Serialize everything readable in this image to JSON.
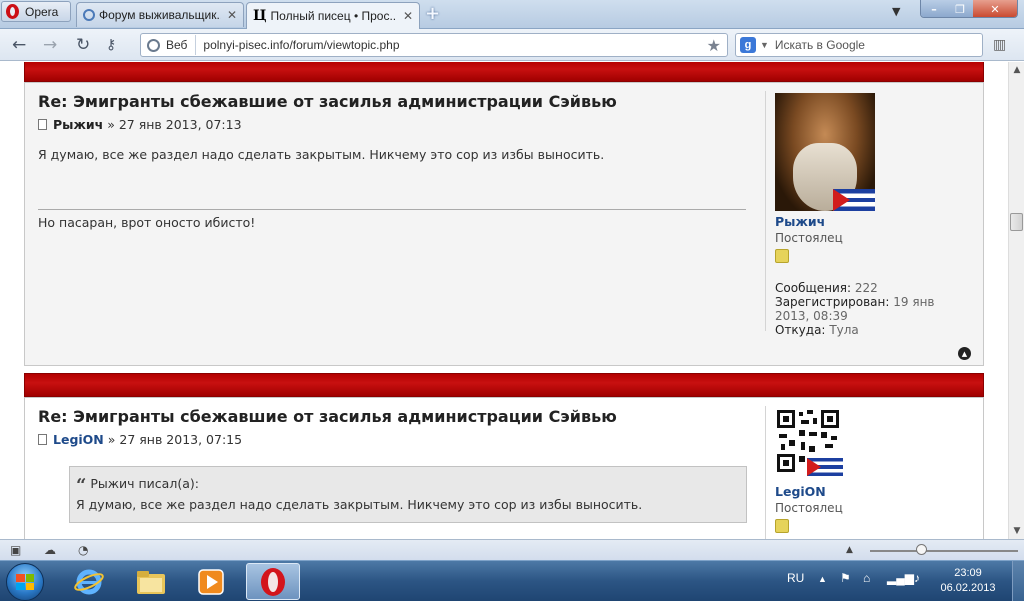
{
  "browser": {
    "menu_label": "Opera",
    "tabs": [
      {
        "label": "Форум выживальщик..."
      },
      {
        "label": "Полный писец • Прос..."
      }
    ],
    "new_tab": "+",
    "window_controls": {
      "minimize": "–",
      "restore": "❐",
      "close": "✕"
    },
    "address": {
      "web_label": "Веб",
      "url": "polnyi-pisec.info/forum/viewtopic.php"
    },
    "search": {
      "engine_letter": "g",
      "placeholder": "Искать в Google"
    }
  },
  "posts": [
    {
      "title": "Re: Эмигранты сбежавшие от засилья администрации Сэйвью",
      "author": "Рыжич",
      "date": "» 27 янв 2013, 07:13",
      "text": "Я думаю, все же раздел надо сделать закрытым. Никчему это сор из избы выносить.",
      "signature": "Но пасаран, врот оносто ибисто!",
      "profile": {
        "username": "Рыжич",
        "rank": "Постоялец",
        "messages_label": "Сообщения:",
        "messages_value": "222",
        "registered_label": "Зарегистрирован:",
        "registered_value": "19 янв",
        "registered_value2": "2013, 08:39",
        "from_label": "Откуда:",
        "from_value": "Тула"
      }
    },
    {
      "title": "Re: Эмигранты сбежавшие от засилья администрации Сэйвью",
      "author": "LegiON",
      "date": "» 27 янв 2013, 07:15",
      "quote_author": "Рыжич писал(а):",
      "quote_text": "Я думаю, все же раздел надо сделать закрытым. Никчему это сор из избы выносить.",
      "profile": {
        "username": "LegiON",
        "rank": "Постоялец"
      }
    }
  ],
  "taskbar": {
    "language": "RU",
    "time": "23:09",
    "date": "06.02.2013"
  },
  "colors": {
    "post_header_bar": "#b30000",
    "username": "#1e4a8a",
    "post_bg": "#f4f4f4"
  }
}
